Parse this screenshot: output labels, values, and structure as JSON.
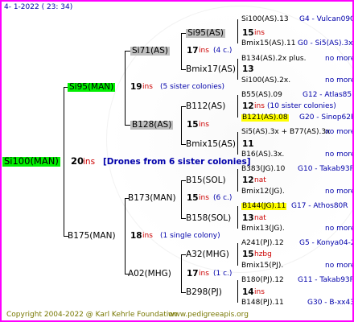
{
  "header": {
    "date": "4-  1-2022 ( 23: 34)"
  },
  "root": {
    "name": "Si100(MAN)",
    "ins_num": "20",
    "ins_label": "ins",
    "note": "[Drones from 6 sister colonies]"
  },
  "gen1": {
    "top": {
      "name": "Si95(MAN)",
      "ins_num": "19",
      "ins_label": "ins",
      "note": "(5 sister colonies)"
    },
    "bottom": {
      "name": "B175(MAN)",
      "ins_num": "18",
      "ins_label": "ins",
      "note": "(1 single colony)"
    }
  },
  "gen2": [
    {
      "name": "Si71(AS)",
      "ins_num": "17",
      "ins_label": "ins",
      "note": "(4 c.)"
    },
    {
      "name": "B128(AS)",
      "ins_num": "15",
      "ins_label": "ins",
      "note": ""
    },
    {
      "name": "B173(MAN)",
      "ins_num": "15",
      "ins_label": "ins",
      "note": "(6 c.)"
    },
    {
      "name": "A02(MHG)",
      "ins_num": "17",
      "ins_label": "ins",
      "note": "(1 c.)"
    }
  ],
  "gen3": [
    {
      "name": "Si95(AS)",
      "ins_num": "15",
      "ins_label": "ins",
      "note": ""
    },
    {
      "name": "Bmix17(AS)",
      "ins_num": "13",
      "ins_label": "",
      "note": ""
    },
    {
      "name": "B112(AS)",
      "ins_num": "12",
      "ins_label": "ins",
      "note": "(10 sister colonies)"
    },
    {
      "name": "Bmix15(AS)",
      "ins_num": "11",
      "ins_label": "",
      "note": ""
    },
    {
      "name": "B15(SOL)",
      "ins_num": "12",
      "ins_label": "nat",
      "note": ""
    },
    {
      "name": "B158(SOL)",
      "ins_num": "13",
      "ins_label": "nat",
      "note": ""
    },
    {
      "name": "A32(MHG)",
      "ins_num": "15",
      "ins_label": "hzbg",
      "note": ""
    },
    {
      "name": "B298(PJ)",
      "ins_num": "14",
      "ins_label": "ins",
      "note": ""
    }
  ],
  "gen4": [
    {
      "name": "Si100(AS).13",
      "right": "G4 - Vulcan09Q"
    },
    {
      "name": "Bmix15(AS).11",
      "right": "G0 - Si5(AS).3x"
    },
    {
      "name": "B134(AS).2x plus.",
      "right": "no more"
    },
    {
      "name": "Si100(AS).2x.",
      "right": "no more"
    },
    {
      "name": "B55(AS).09",
      "right": "G12 - Atlas85R"
    },
    {
      "name": "B121(AS).08",
      "right": "G20 - Sinop62R"
    },
    {
      "name": "Si5(AS).3x + B77(AS).3x",
      "right": "no more"
    },
    {
      "name": "B16(AS).3x.",
      "right": "no more"
    },
    {
      "name": "B383(JG).10",
      "right": "G10 - Takab93R"
    },
    {
      "name": "Bmix12(JG).",
      "right": "no more"
    },
    {
      "name": "B144(JG).11",
      "right": "G17 - Athos80R"
    },
    {
      "name": "Bmix13(JG).",
      "right": "no more"
    },
    {
      "name": "A241(PJ).12",
      "right": "G5 - Konya04-2"
    },
    {
      "name": "Bmix15(PJ).",
      "right": "no more"
    },
    {
      "name": "B180(PJ).12",
      "right": "G11 - Takab93R"
    },
    {
      "name": "B148(PJ).11",
      "right": "G30 - B-xx43"
    }
  ],
  "footer": {
    "copyright": "Copyright 2004-2022 @ Karl Kehrle Foundation",
    "site": "www.pedigreeapis.org"
  },
  "colors": {
    "border": "#ff00ff",
    "green_highlight": "#00ee00",
    "gray_highlight": "#bfbfbf",
    "yellow_highlight": "#ffff00",
    "red": "#cc0000",
    "blue": "#0000aa",
    "footer": "#777700"
  }
}
